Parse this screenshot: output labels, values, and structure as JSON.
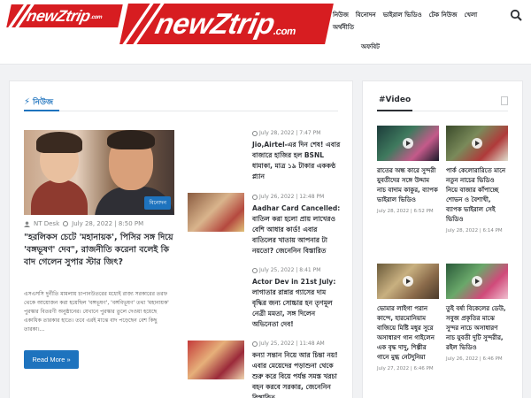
{
  "header": {
    "logo_small": {
      "main": "newZtrip",
      "suffix": ".com"
    },
    "logo_big": {
      "main": "newZtrip",
      "suffix": ".com"
    },
    "nav": [
      "নিউজ",
      "বিনোদন",
      "ভাইরাল ভিডিও",
      "টেক নিউজ",
      "খেলা",
      "অর্থনীতি",
      "অফবিট"
    ],
    "search_icon": "search-icon"
  },
  "left": {
    "section_title": "নিউজ",
    "main": {
      "category": "বিনোদন",
      "author": "NT Desk",
      "date": "July 28, 2022 | 8:50 PM",
      "title": "\"হরলিকস চেটে 'মহানায়ক', পিসির সঙ্গ দিয়ে 'বঙ্গভূষণ' দেব\", রাজনীতি করেনা বলেই কি বাদ গেলেন সুপার স্টার জিৎ?",
      "excerpt": "এসএসসি দুর্নীতি মামলায় চাপানউতরের মধ্যেই রাজ্য সরকারের তরফ থেকে আয়োজন করা হয়েছিল 'বঙ্গভূষণ', 'বঙ্গবিভূষণ' তথা 'মহানায়ক' পুরস্কার বিতরণী অনুষ্ঠানের। যেখানে পুরস্কার তুলে দেওয়া হয়েছে একাধিক তারকার হাতে। তবে এরই মাঝে বাদ পড়েছেন বেশ কিছু তারকা।...",
      "more_label": "Read More »"
    },
    "posts": [
      {
        "date": "July 28, 2022 | 7:47 PM",
        "title": "Jio,Airtel-এর দিন শেষ! এবার বাজারে হাজির হল BSNL ধামাকা, মাত্র ১৯ টাকার এককণ্ঠ প্ল্যান"
      },
      {
        "date": "July 26, 2022 | 12:48 PM",
        "title": "Aadhar Card Cancelled: বাতিল করা হলো প্রায় লাখেরও বেশি আধার কার্ড! এবার বাতিলের খাতায় আপনার টা নয়তো? জেনেনিন বিস্তারিত"
      },
      {
        "date": "July 25, 2022 | 8:41 PM",
        "title": "Actor Dev in 21st July: লাগাতার রান্নার গ্যাসের দাম বৃদ্ধির জন্য সোচ্চার হন তৃণমূল নেত্রী মমতা, সঙ্গ দিলেন অভিনেতা দেব!"
      },
      {
        "date": "July 25, 2022 | 11:48 AM",
        "title": "কন্যা সন্তান নিয়ে আর চিন্তা নয়! এবার মেয়েদের পড়াশুনা থেকে শুরু করে বিয়ে পর্যন্ত সমস্ত খরচা বহন করবে সরকার, জেনেনিন বিস্তারিত"
      }
    ]
  },
  "right": {
    "widget_title": "#Video",
    "videos": [
      {
        "title": "রাতের অন্ধ কারে সুন্দরী যুবতীদের সঙ্গে উদ্দাম নাচ বাদাম কাকুর, ব্যাপক ভাইরাল ভিডিও",
        "date": "July 28, 2022 | 6:52 PM"
      },
      {
        "title": "পার্ক কেলোরারিতে মানে নতুন নাচের ভিডিও নিয়ে বাজার কাঁপাচ্ছে শোভন ও বৈশাখী, ব্যাপক ভাইরাল সেই ভিডিও",
        "date": "July 28, 2022 | 6:14 PM"
      },
      {
        "title": "ভোমার লাইগা পরান কান্দে, হারমোনিয়াম বাজিয়ে মিষ্টি মধুর সুরে অসাধারণ গান গাইলেন এক বৃদ্ধ দাদু, শিল্পীর গানে মুগ্ধ নেটদুনিয়া",
        "date": "July 27, 2022 | 6:46 PM"
      },
      {
        "title": "তুই বর্ষা বিকেলের ডেউ, সবুজ প্রকৃতির মাঝে সুন্দর নাচে অসাধারণ নাচ যুবতী দুটি সুন্দরীর, রইল ভিডিও",
        "date": "July 26, 2022 | 6:46 PM"
      }
    ]
  }
}
